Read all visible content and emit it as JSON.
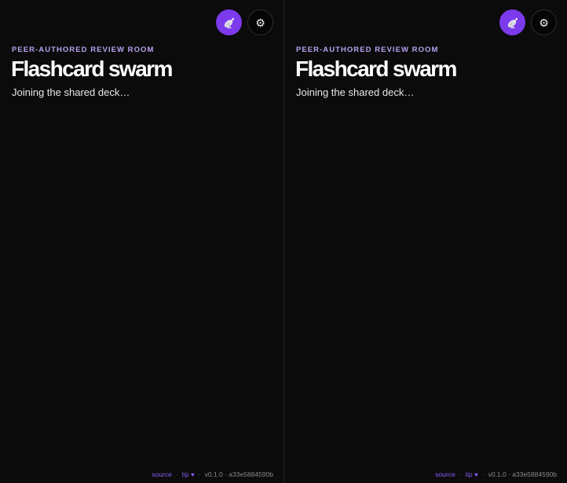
{
  "colors": {
    "accent": "#7c3aed",
    "eyebrow": "#b8a2f0",
    "link": "#8b5cf6",
    "heart": "#8b5cf6"
  },
  "panes": [
    {
      "header": {
        "broadcast_icon": "satellite-dish-icon",
        "settings_icon": "gear-icon"
      },
      "eyebrow": "PEER-AUTHORED REVIEW ROOM",
      "title": "Flashcard swarm",
      "status": "Joining the shared deck…",
      "footer": {
        "source_label": "source",
        "sep1": "·",
        "tip_label": "tip",
        "heart": "♥",
        "sep2": "·",
        "version": "v0.1.0 · a33e5884590b"
      }
    },
    {
      "header": {
        "broadcast_icon": "satellite-dish-icon",
        "settings_icon": "gear-icon"
      },
      "eyebrow": "PEER-AUTHORED REVIEW ROOM",
      "title": "Flashcard swarm",
      "status": "Joining the shared deck…",
      "footer": {
        "source_label": "source",
        "sep1": "·",
        "tip_label": "tip",
        "heart": "♥",
        "sep2": "·",
        "version": "v0.1.0 · a33e5884590b"
      }
    }
  ]
}
